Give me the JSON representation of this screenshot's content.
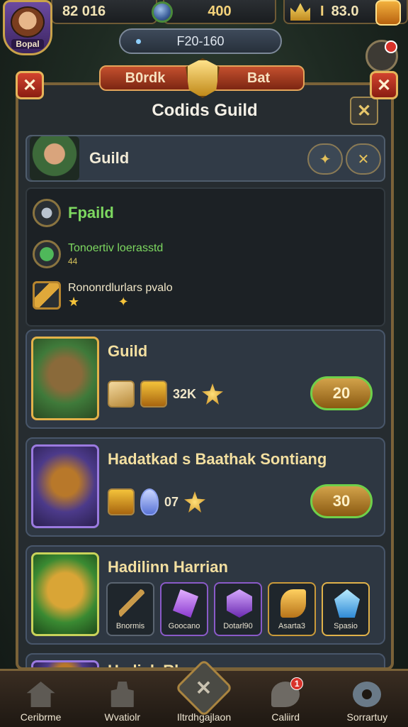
{
  "hud": {
    "player_name": "Bopal",
    "resource_a": "82 016",
    "resource_b": "400",
    "resource_c_sep": "I",
    "resource_c": "83.0",
    "sub_value": "F20-160"
  },
  "banner": {
    "left_label": "B0rdk",
    "right_label": "Bat"
  },
  "panel": {
    "title": "Codids Guild",
    "guild_name": "Guild",
    "info": {
      "row1": "Fpaild",
      "row2_line1": "Tonoertiv loerasstd",
      "row2_line2": "44",
      "row3": "Rononrdlurlars pvalo"
    },
    "cards": [
      {
        "title": "Guild",
        "count": "32K",
        "price": "20"
      },
      {
        "title": "Hadatkad s Baathak Sontiang",
        "count": "07",
        "price": "30"
      },
      {
        "title": "Hadilinn Harrian",
        "slots": [
          {
            "label": "Bnormis",
            "icon": "wand-icon"
          },
          {
            "label": "Goocano",
            "icon": "amethyst-icon"
          },
          {
            "label": "Dotarl90",
            "icon": "cube-icon"
          },
          {
            "label": "Asarta3",
            "icon": "horn-icon"
          },
          {
            "label": "Spasio",
            "icon": "sapphire-icon"
          }
        ]
      },
      {
        "title": "Hadiak Rh"
      }
    ]
  },
  "bottom_nav": {
    "items": [
      {
        "label": "Ceribrme"
      },
      {
        "label": "Wvatiolr"
      },
      {
        "label": "Iltrdhgajlaon"
      },
      {
        "label": "Caliird",
        "badge": "1"
      },
      {
        "label": "Sorrartuy"
      }
    ]
  },
  "colors": {
    "frame_gold": "#7a6238",
    "accent_green": "#7dd860",
    "price_border": "#6fd04a",
    "close_red": "#d2432e"
  }
}
